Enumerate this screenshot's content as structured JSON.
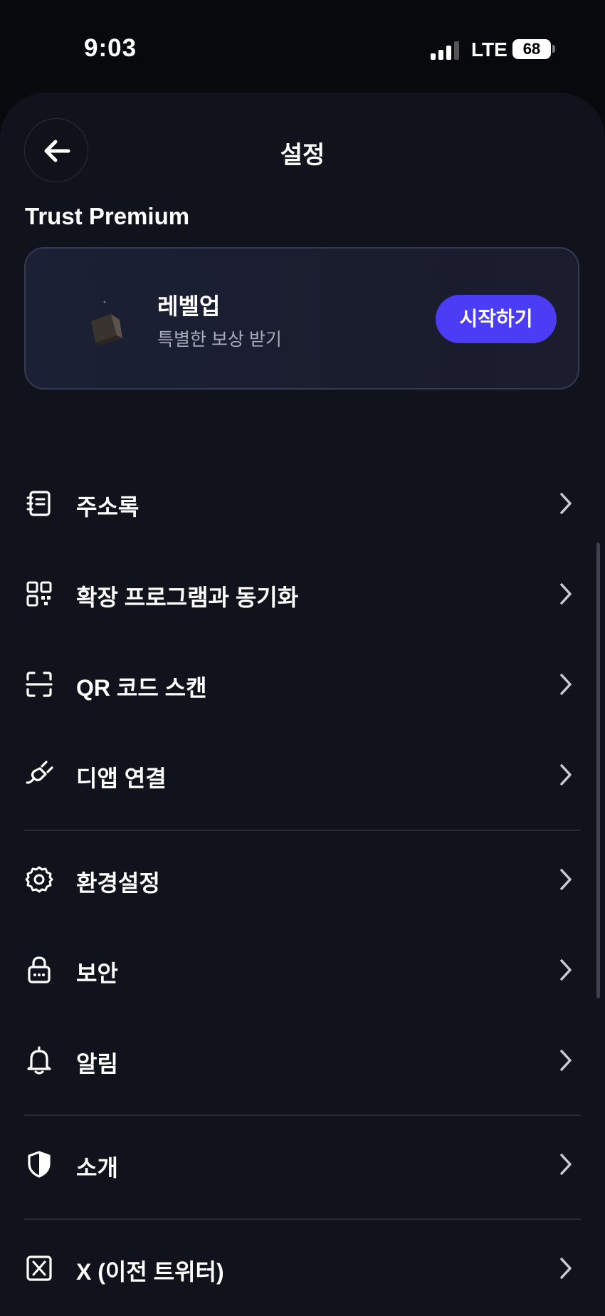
{
  "status_bar": {
    "time": "9:03",
    "network": "LTE",
    "battery": "68"
  },
  "header": {
    "title": "설정"
  },
  "premium": {
    "section_title": "Trust Premium",
    "card_title": "레벨업",
    "card_subtitle": "특별한 보상 받기",
    "button_label": "시작하기"
  },
  "menu": {
    "items": [
      {
        "label": "주소록",
        "icon": "address-book-icon"
      },
      {
        "label": "확장 프로그램과 동기화",
        "icon": "qr-grid-icon"
      },
      {
        "label": "QR 코드 스캔",
        "icon": "scan-icon"
      },
      {
        "label": "디앱 연결",
        "icon": "plug-icon"
      },
      {
        "label": "환경설정",
        "icon": "gear-icon"
      },
      {
        "label": "보안",
        "icon": "lock-icon"
      },
      {
        "label": "알림",
        "icon": "bell-icon"
      },
      {
        "label": "소개",
        "icon": "shield-icon"
      },
      {
        "label": "X (이전 트위터)",
        "icon": "x-logo-icon"
      }
    ]
  },
  "colors": {
    "background": "#11131c",
    "accent": "#4a3df5",
    "card_border": "#333b54"
  }
}
